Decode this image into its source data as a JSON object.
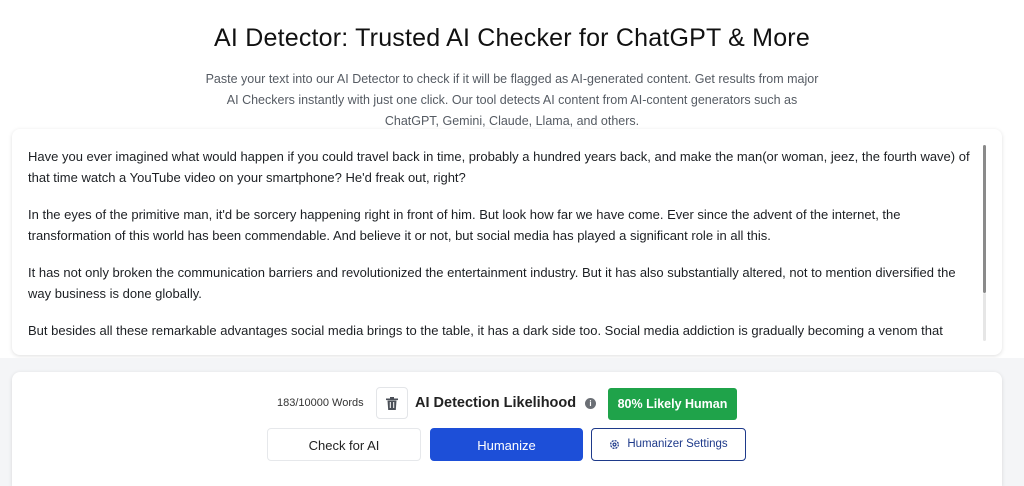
{
  "header": {
    "title": "AI Detector: Trusted AI Checker for ChatGPT & More",
    "subtitle": "Paste your text into our AI Detector to check if it will be flagged as AI-generated content. Get results from major AI Checkers instantly with just one click. Our tool detects AI content from AI-content generators such as ChatGPT, Gemini, Claude, Llama, and others."
  },
  "editor": {
    "paragraphs": [
      "Have you ever imagined what would happen if you could travel back in time, probably a hundred years back, and make the man(or woman, jeez, the fourth wave) of that time watch a YouTube video on your smartphone? He'd freak out, right?",
      "In the eyes of the primitive man, it'd be sorcery happening right in front of him. But look how far we have come. Ever since the advent of the internet, the transformation of this world has been commendable. And believe it or not, but social media has played a significant role in all this.",
      "It has not only broken the communication barriers and revolutionized the entertainment industry. But it has also substantially altered, not to mention diversified the way business is done globally.",
      "But besides all these remarkable advantages social media brings to the table, it has a dark side too. Social media addiction is gradually becoming a venom that"
    ]
  },
  "controls": {
    "word_count": "183/10000 Words",
    "likelihood_label": "AI Detection Likelihood",
    "result_badge": "80% Likely Human",
    "check_label": "Check for AI",
    "humanize_label": "Humanize",
    "settings_label": "Humanizer Settings"
  },
  "colors": {
    "accent_blue": "#1d4fd8",
    "badge_green": "#1fa34a",
    "settings_border": "#1e3a8a"
  },
  "icons": {
    "trash": "trash-icon",
    "info": "info-icon",
    "settings": "gear-icon"
  }
}
